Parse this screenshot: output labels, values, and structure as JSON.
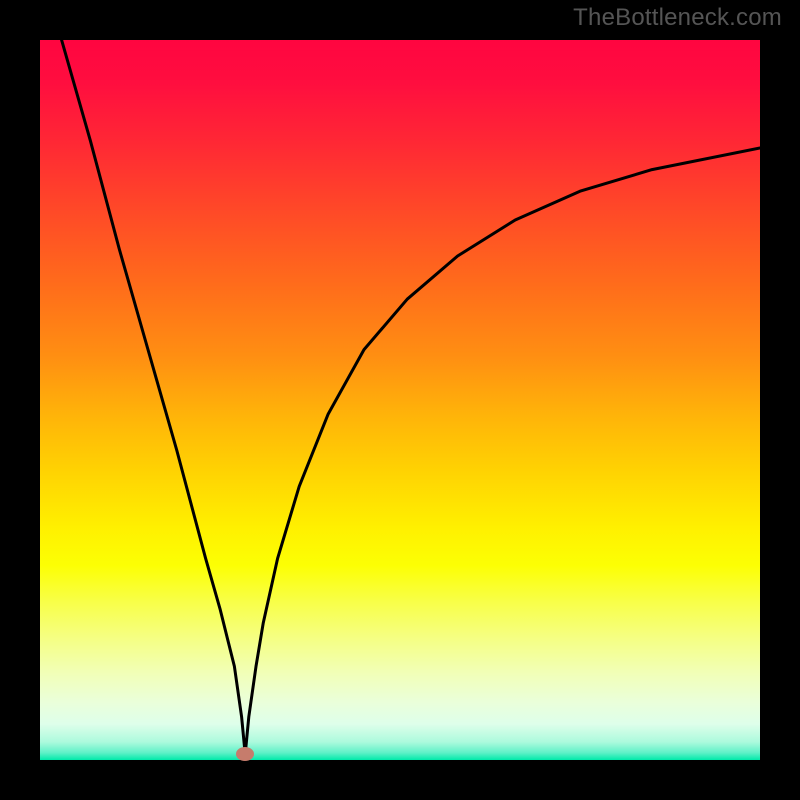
{
  "watermark": "TheBottleneck.com",
  "chart_data": {
    "type": "line",
    "title": "",
    "xlabel": "",
    "ylabel": "",
    "xlim": [
      0,
      100
    ],
    "ylim": [
      0,
      100
    ],
    "grid": false,
    "legend": false,
    "marker": {
      "x": 28.5,
      "y": 0.8,
      "color": "#c67c6c"
    },
    "series": [
      {
        "name": "bottleneck-curve",
        "x": [
          3,
          7,
          11,
          15,
          19,
          23,
          25,
          26,
          27,
          28,
          28.5,
          29,
          30,
          31,
          33,
          36,
          40,
          45,
          51,
          58,
          66,
          75,
          85,
          100
        ],
        "y": [
          100,
          86,
          71,
          57,
          43,
          28,
          21,
          17,
          13,
          6,
          0.8,
          6,
          13,
          19,
          28,
          38,
          48,
          57,
          64,
          70,
          75,
          79,
          82,
          85
        ]
      }
    ],
    "background_gradient_stops": [
      {
        "pos": 0,
        "color": "#ff0540"
      },
      {
        "pos": 50,
        "color": "#ffb309"
      },
      {
        "pos": 70,
        "color": "#fff100"
      },
      {
        "pos": 90,
        "color": "#eaffda"
      },
      {
        "pos": 100,
        "color": "#00eaaa"
      }
    ]
  }
}
